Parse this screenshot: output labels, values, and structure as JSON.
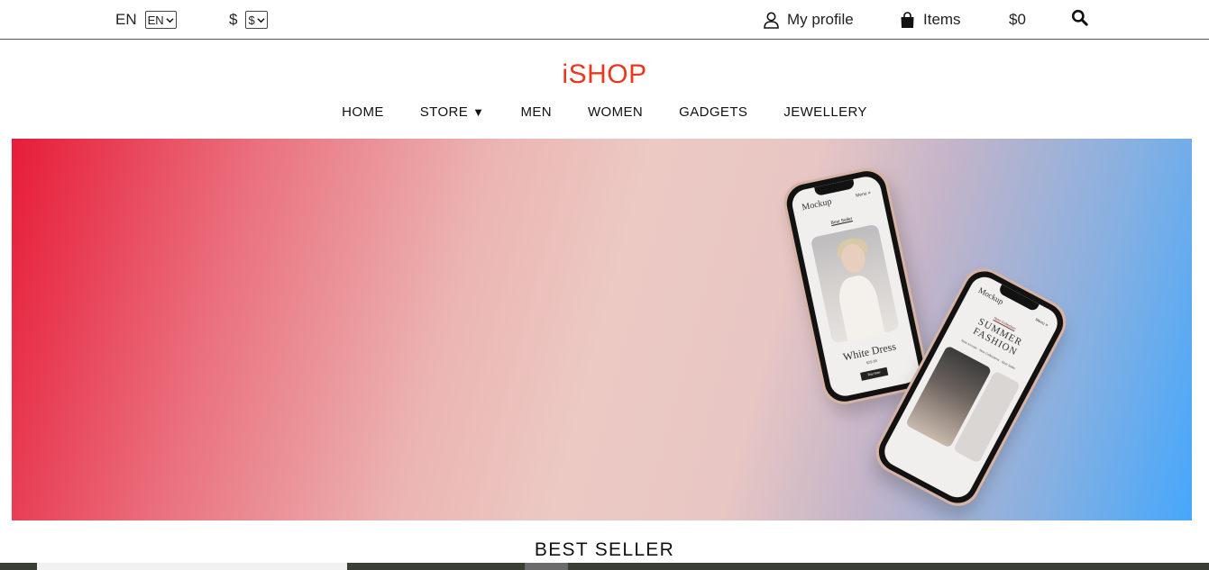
{
  "topbar": {
    "language": {
      "label": "EN",
      "selected": "EN"
    },
    "currency": {
      "label": "$",
      "selected": "$"
    },
    "profile_label": "My profile",
    "cart_label": "Items",
    "cart_total": "$0",
    "icons": {
      "profile": "user-icon",
      "cart": "shopping-bag-icon",
      "search": "search-icon"
    }
  },
  "brand": {
    "logo": "iSHOP",
    "color": "#e8391f"
  },
  "nav": {
    "items": [
      {
        "label": "HOME"
      },
      {
        "label": "STORE",
        "caret": "▼"
      },
      {
        "label": "MEN"
      },
      {
        "label": "WOMEN"
      },
      {
        "label": "GADGETS"
      },
      {
        "label": "JEWELLERY"
      }
    ]
  },
  "hero": {
    "colors": {
      "left": "#e71c39",
      "middle": "#ecc9c3",
      "right": "#46a7fb"
    },
    "phone_back": {
      "brand": "Mockup",
      "menu": "Menu ≡",
      "section": "Best Seller",
      "product": "White Dress",
      "price": "$29.99",
      "button": "Buy Now"
    },
    "phone_front": {
      "brand": "Mockup",
      "menu": "Menu ≡",
      "kicker": "New Collection",
      "headline_line1": "SUMMER",
      "headline_line2": "FASHION",
      "links": "New Arrivals · New Collections · Best Seller"
    }
  },
  "sections": {
    "best_seller": "BEST SELLER"
  }
}
